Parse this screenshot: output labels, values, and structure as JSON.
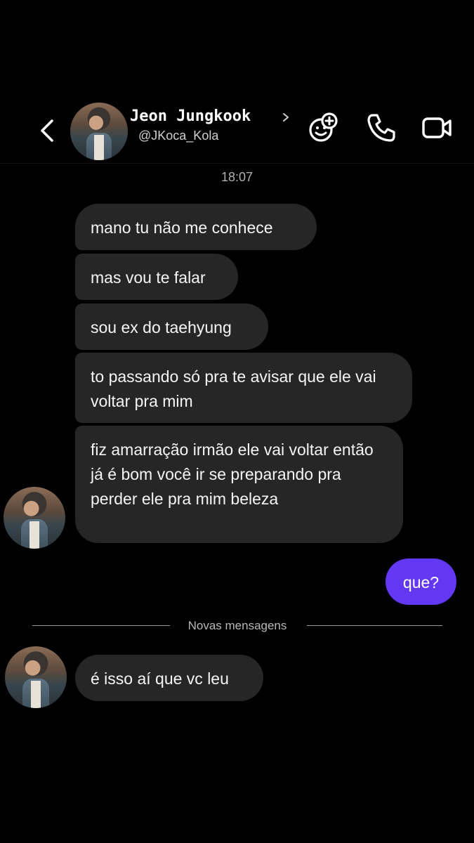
{
  "header": {
    "name": "Jeon  Jungkook",
    "username": "@JKoca_Kola",
    "back_icon": "chevron-left-icon",
    "name_chevron_icon": "chevron-right-icon",
    "actions": [
      "add-effects-icon",
      "phone-icon",
      "video-icon"
    ]
  },
  "conversation": {
    "timestamp": "18:07",
    "incoming": [
      "mano tu não me conhece",
      "mas vou te falar",
      "sou ex do taehyung",
      "to passando só pra te avisar que ele vai voltar pra mim",
      "fiz amarração irmão ele vai voltar então já é bom você ir se preparando pra perder ele pra mim beleza"
    ],
    "outgoing": [
      "que?"
    ],
    "divider_label": "Novas mensagens",
    "new_incoming": [
      "é isso aí que vc leu"
    ]
  },
  "colors": {
    "background": "#000000",
    "incoming_bubble": "#262626",
    "outgoing_bubble": "#6338f2",
    "text": "#ffffff"
  }
}
